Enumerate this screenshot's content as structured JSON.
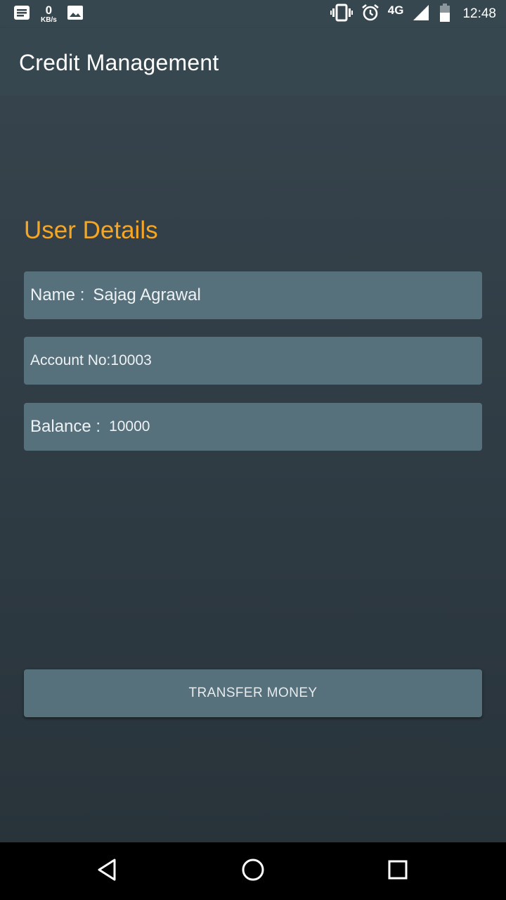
{
  "status_bar": {
    "net_speed_value": "0",
    "net_speed_unit": "KB/s",
    "network_type": "4G",
    "time": "12:48",
    "icons": [
      "notification-icon",
      "image-icon",
      "vibrate-icon",
      "alarm-icon",
      "signal-icon",
      "battery-icon"
    ]
  },
  "app_bar": {
    "title": "Credit Management"
  },
  "user_details": {
    "heading": "User Details",
    "name_label": "Name :",
    "name_value": "Sajag Agrawal",
    "account_label": "Account No:",
    "account_value": "10003",
    "balance_label": "Balance :",
    "balance_value": "10000"
  },
  "actions": {
    "transfer_label": "TRANSFER MONEY"
  },
  "nav_bar": {
    "icons": [
      "back-icon",
      "home-icon",
      "recent-apps-icon"
    ]
  },
  "colors": {
    "app_bar": "#37474f",
    "accent": "#f5a623",
    "field_bg": "#56707c",
    "background": "#2e3a42"
  }
}
